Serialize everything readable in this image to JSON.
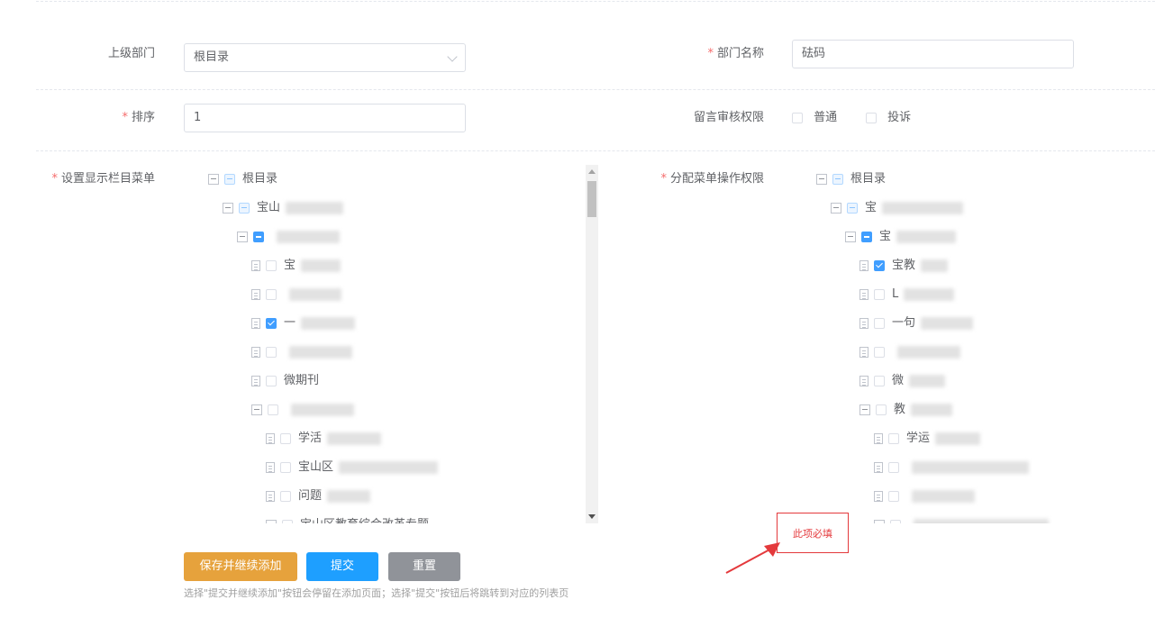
{
  "form": {
    "parent_dept_label": "上级部门",
    "parent_dept_value": "根目录",
    "dept_name_label": "部门名称",
    "dept_name_value": "砝码",
    "sort_label": "排序",
    "sort_value": "1",
    "review_label": "留言审核权限",
    "review_options": [
      "普通",
      "投诉"
    ],
    "display_menu_label": "设置显示栏目菜单",
    "assign_menu_label": "分配菜单操作权限",
    "required_mark": "*"
  },
  "left_tree": [
    {
      "text": "根目录",
      "blur": 0,
      "state": "lightindet",
      "toggle": true
    },
    {
      "text": "宝山",
      "blur": 64,
      "state": "lightindet",
      "toggle": true
    },
    {
      "text": "",
      "blur": 70,
      "state": "indet",
      "toggle": true
    },
    {
      "text": "宝",
      "blur": 44,
      "state": "unchecked",
      "doc": true
    },
    {
      "text": "",
      "blur": 58,
      "state": "unchecked",
      "doc": true
    },
    {
      "text": "一",
      "blur": 60,
      "state": "checked",
      "doc": true
    },
    {
      "text": "",
      "blur": 70,
      "state": "unchecked",
      "doc": true
    },
    {
      "text": "微期刊",
      "blur": 0,
      "state": "unchecked",
      "doc": true
    },
    {
      "text": "",
      "blur": 70,
      "state": "unchecked",
      "toggle": true
    },
    {
      "text": "学活",
      "blur": 60,
      "state": "unchecked",
      "doc": true
    },
    {
      "text": "宝山区",
      "blur": 110,
      "state": "unchecked",
      "doc": true
    },
    {
      "text": "问题",
      "blur": 48,
      "state": "unchecked",
      "doc": true
    },
    {
      "text": "宝山区教育综合改革专题",
      "blur": 0,
      "state": "unchecked",
      "toggle": true
    }
  ],
  "right_tree": [
    {
      "text": "根目录",
      "blur": 0,
      "state": "lightindet",
      "toggle": true
    },
    {
      "text": "宝",
      "blur": 90,
      "state": "lightindet",
      "toggle": true
    },
    {
      "text": "宝",
      "blur": 66,
      "state": "indet",
      "toggle": true
    },
    {
      "text": "宝教",
      "blur": 30,
      "state": "checked",
      "doc": true
    },
    {
      "text": "L",
      "blur": 56,
      "state": "unchecked",
      "doc": true
    },
    {
      "text": "一句",
      "blur": 58,
      "state": "unchecked",
      "doc": true
    },
    {
      "text": "",
      "blur": 70,
      "state": "unchecked",
      "doc": true
    },
    {
      "text": "微",
      "blur": 40,
      "state": "unchecked",
      "doc": true
    },
    {
      "text": "教",
      "blur": 46,
      "state": "unchecked",
      "toggle": true
    },
    {
      "text": "学运",
      "blur": 50,
      "state": "unchecked",
      "doc": true
    },
    {
      "text": "",
      "blur": 130,
      "state": "unchecked",
      "doc": true
    },
    {
      "text": "",
      "blur": 70,
      "state": "unchecked",
      "doc": true
    },
    {
      "text": "",
      "blur": 150,
      "state": "unchecked",
      "toggle": true
    }
  ],
  "buttons": {
    "save_continue": "保存并继续添加",
    "submit": "提交",
    "reset": "重置"
  },
  "hint": "选择\"提交并继续添加\"按钮会停留在添加页面；选择\"提交\"按钮后将跳转到对应的列表页",
  "validation_tooltip": "此项必填",
  "colors": {
    "save_continue": "#e6a23c",
    "submit": "#1e9fff",
    "reset": "#909399",
    "checkbox_checked": "#409eff",
    "required": "#f56c6c",
    "annotation": "#e4393c"
  }
}
